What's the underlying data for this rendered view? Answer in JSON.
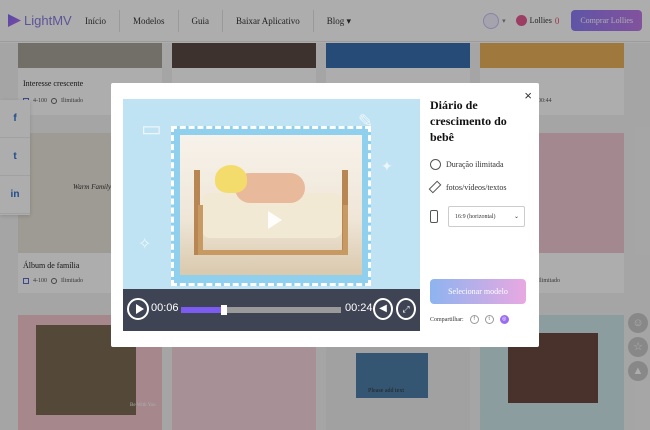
{
  "nav": {
    "logo": "LightMV",
    "menu": [
      "Início",
      "Modelos",
      "Guia",
      "Baixar Aplicativo",
      "Blog"
    ],
    "blog_caret": "▾",
    "lollies_label": "Lollies",
    "lollies_count": "0",
    "buy_button": "Comprar Lollies"
  },
  "cards": [
    {
      "title": "Interesse crescente",
      "count": "4-100",
      "duration": "Ilimitado"
    },
    {
      "title": "Álbum de família",
      "count": "4-100",
      "duration": "Ilimitado",
      "thumb_text": "Warm Family"
    },
    {
      "title": "",
      "count": "",
      "duration": "Ilimitado"
    },
    {
      "title": "",
      "count": "",
      "duration": "00:44"
    }
  ],
  "bottom_thumb_text": [
    "Please add text",
    "Be With You"
  ],
  "social": [
    "f",
    "t",
    "in"
  ],
  "modal": {
    "close": "×",
    "title": "Diário de crescimento do bebê",
    "features": [
      "Duração ilimitada",
      "fotos/vídeos/textos"
    ],
    "ratio_select": "16:9 (horizontal)",
    "select_button": "Selecionar modelo",
    "share_label": "Compartilhar:",
    "share_icons": [
      "f",
      "t",
      "◎"
    ]
  },
  "player": {
    "current_time": "00:06",
    "total_time": "00:24",
    "progress": 0.25
  },
  "colors": {
    "accent": "#7c5cf0",
    "brand_gradient_start": "#8d7cf5",
    "brand_gradient_end": "#c07ae8"
  }
}
